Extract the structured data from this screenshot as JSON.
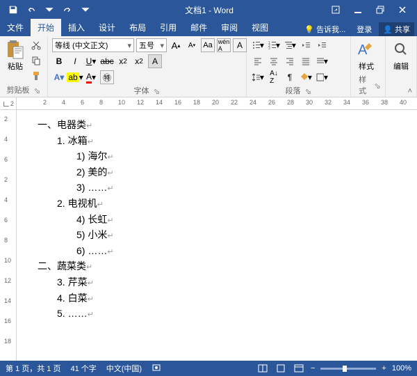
{
  "title": "文档1 - Word",
  "tabs": {
    "file": "文件",
    "home": "开始",
    "insert": "插入",
    "design": "设计",
    "layout": "布局",
    "references": "引用",
    "mail": "邮件",
    "review": "审阅",
    "view": "视图",
    "tellme": "告诉我...",
    "login": "登录",
    "share": "共享"
  },
  "ribbon": {
    "clipboard": {
      "paste": "粘贴",
      "label": "剪贴板"
    },
    "font": {
      "name": "等线 (中文正文)",
      "size": "五号",
      "label": "字体"
    },
    "paragraph": {
      "label": "段落"
    },
    "styles": {
      "btn": "样式",
      "label": "样式"
    },
    "editing": {
      "btn": "编辑"
    }
  },
  "ruler": {
    "corner": "2",
    "h": [
      "2",
      "4",
      "6",
      "8",
      "10",
      "12",
      "14",
      "16",
      "18",
      "20",
      "22",
      "24",
      "26",
      "28",
      "30",
      "32",
      "34",
      "36",
      "38",
      "40"
    ],
    "v": [
      "2",
      "4",
      "6",
      "2",
      "4",
      "6",
      "8",
      "10",
      "12",
      "14",
      "16",
      "18"
    ]
  },
  "document": {
    "lines": [
      {
        "lvl": 0,
        "text": "一、电器类"
      },
      {
        "lvl": 1,
        "text": "1.  冰箱"
      },
      {
        "lvl": 2,
        "text": "1)   海尔"
      },
      {
        "lvl": 2,
        "text": "2)   美的"
      },
      {
        "lvl": 2,
        "text": "3)   ……"
      },
      {
        "lvl": 1,
        "text": "2.  电视机"
      },
      {
        "lvl": 2,
        "text": "4)   长虹"
      },
      {
        "lvl": 2,
        "text": "5)   小米"
      },
      {
        "lvl": 2,
        "text": "6)   ……"
      },
      {
        "lvl": 0,
        "text": "二、蔬菜类"
      },
      {
        "lvl": 1,
        "text": "3.  芹菜"
      },
      {
        "lvl": 1,
        "text": "4.  白菜"
      },
      {
        "lvl": 1,
        "text": "5.  ……"
      }
    ]
  },
  "status": {
    "page": "第 1 页，共 1 页",
    "words": "41 个字",
    "lang": "中文(中国)",
    "zoom": "100%"
  }
}
